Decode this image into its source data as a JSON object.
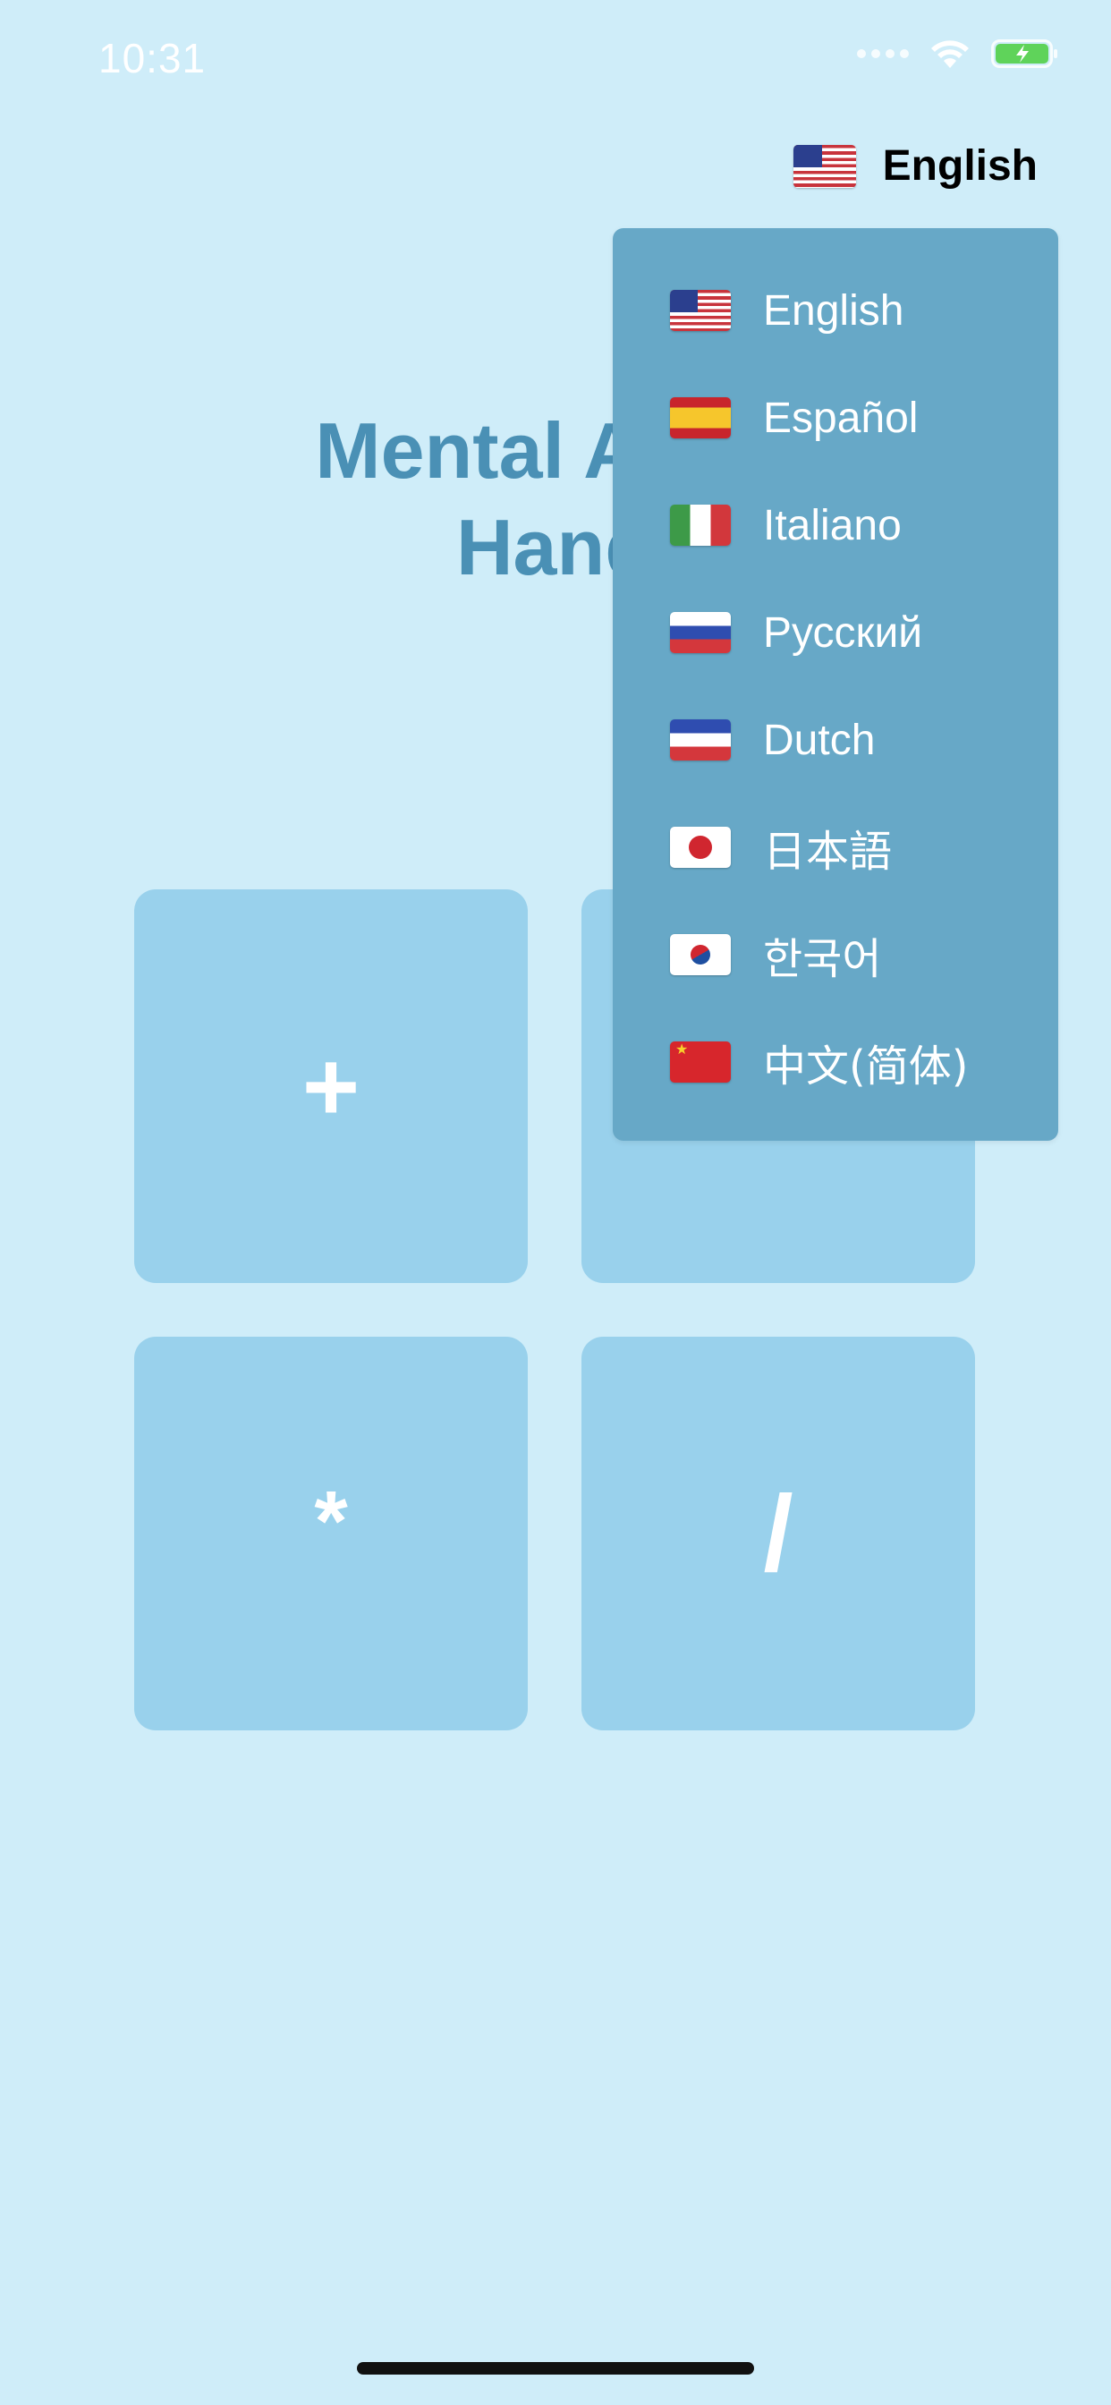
{
  "status_bar": {
    "time": "10:31"
  },
  "header": {
    "language_selector": {
      "label": "English",
      "flag": "us-flag-icon"
    }
  },
  "title": {
    "line1": "Mental Arit",
    "line2": "Hand"
  },
  "operations": [
    {
      "symbol": "+"
    },
    {
      "symbol": "-"
    },
    {
      "symbol": "*"
    },
    {
      "symbol": "/"
    }
  ],
  "language_menu": {
    "items": [
      {
        "label": "English",
        "flag": "us-flag-icon"
      },
      {
        "label": "Español",
        "flag": "spain-flag-icon"
      },
      {
        "label": "Italiano",
        "flag": "italy-flag-icon"
      },
      {
        "label": "Русский",
        "flag": "russia-flag-icon"
      },
      {
        "label": "Dutch",
        "flag": "netherlands-flag-icon"
      },
      {
        "label": "日本語",
        "flag": "japan-flag-icon"
      },
      {
        "label": "한국어",
        "flag": "korea-flag-icon"
      },
      {
        "label": "中文(简体)",
        "flag": "china-flag-icon"
      }
    ]
  },
  "colors": {
    "background": "#cfedf9",
    "title": "#4a90b5",
    "button": "#99d1ec",
    "menu": "#67a8c7",
    "menu_text": "#ffffff"
  }
}
